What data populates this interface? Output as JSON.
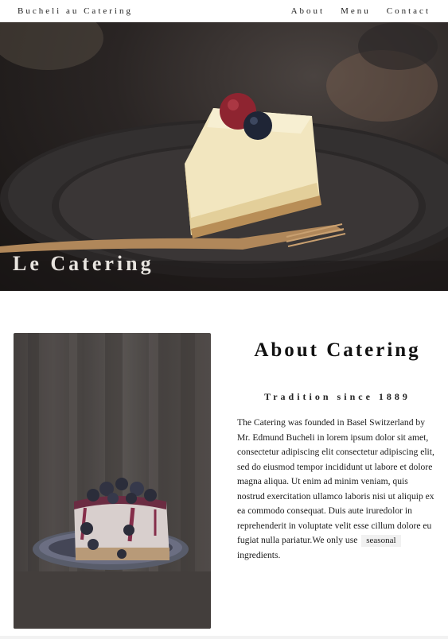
{
  "nav": {
    "brand": "Bucheli au Catering",
    "links": [
      "About",
      "Menu",
      "Contact"
    ]
  },
  "hero": {
    "title": "Le Catering"
  },
  "about": {
    "title": "About Catering",
    "subtitle": "Tradition since 1889",
    "body": "The Catering was founded in Basel Switzerland by Mr. Edmund Bucheli in lorem ipsum dolor sit amet, consectetur adipiscing elit consectetur adipiscing elit, sed do eiusmod tempor incididunt ut labore et dolore magna aliqua. Ut enim ad minim veniam, quis nostrud exercitation ullamco laboris nisi ut aliquip ex ea commodo consequat. Duis aute iruredolor in reprehenderit in voluptate velit esse cillum dolore eu fugiat nulla pariatur.We only use",
    "tag": "seasonal",
    "body_end": "ingredients."
  },
  "icons": {
    "hero_image": "cheesecake-slice-image",
    "about_image": "blueberry-cheesecake-image"
  }
}
